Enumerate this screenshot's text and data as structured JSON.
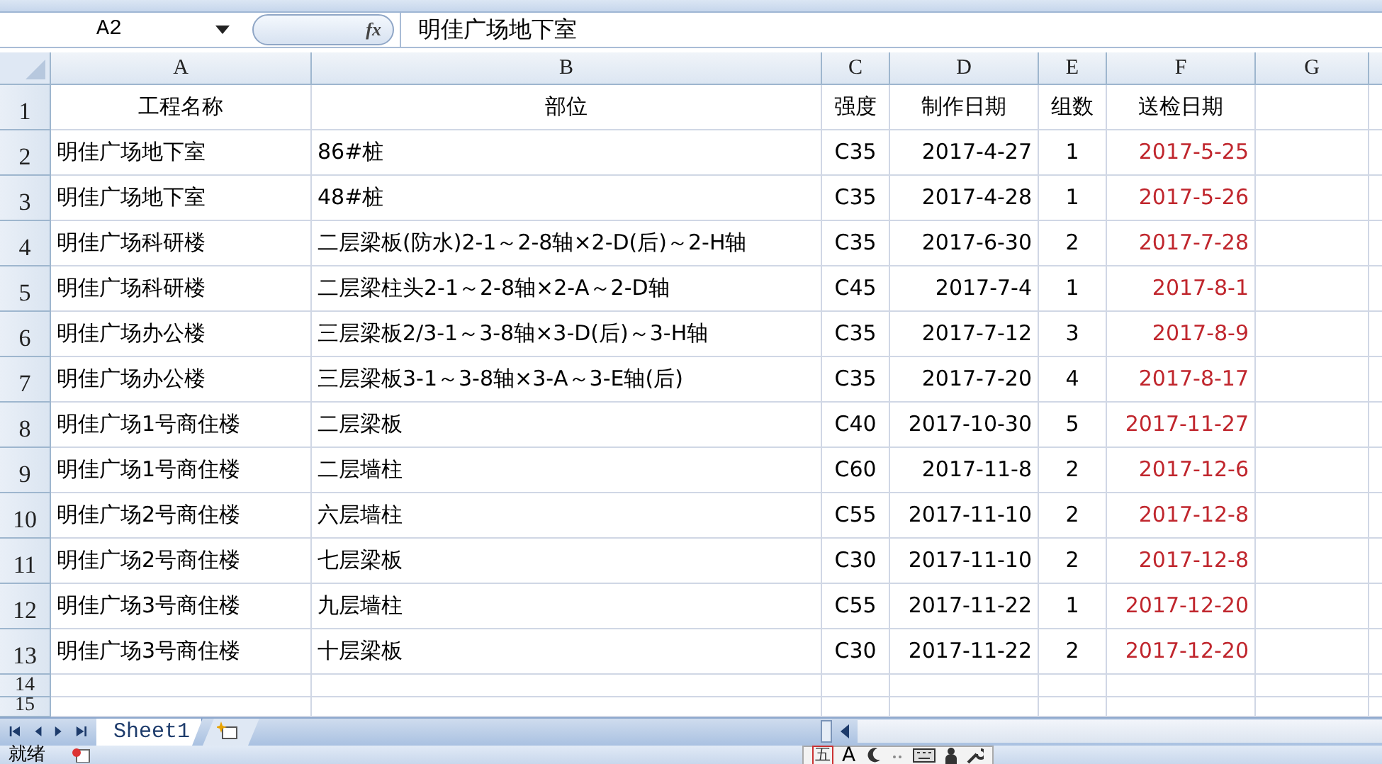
{
  "formula_bar": {
    "name_box": "A2",
    "fx": "fx",
    "value": "明佳广场地下室"
  },
  "columns": [
    "A",
    "B",
    "C",
    "D",
    "E",
    "F",
    "G"
  ],
  "header_row": {
    "number": "1",
    "cells": [
      "工程名称",
      "部位",
      "强度",
      "制作日期",
      "组数",
      "送检日期"
    ]
  },
  "rows": [
    {
      "number": "2",
      "cells": [
        "明佳广场地下室",
        "86#桩",
        "C35",
        "2017-4-27",
        "1",
        "2017-5-25"
      ]
    },
    {
      "number": "3",
      "cells": [
        "明佳广场地下室",
        "48#桩",
        "C35",
        "2017-4-28",
        "1",
        "2017-5-26"
      ]
    },
    {
      "number": "4",
      "cells": [
        "明佳广场科研楼",
        "二层梁板(防水)2-1～2-8轴×2-D(后)～2-H轴",
        "C35",
        "2017-6-30",
        "2",
        "2017-7-28"
      ]
    },
    {
      "number": "5",
      "cells": [
        "明佳广场科研楼",
        "二层梁柱头2-1～2-8轴×2-A～2-D轴",
        "C45",
        "2017-7-4",
        "1",
        "2017-8-1"
      ]
    },
    {
      "number": "6",
      "cells": [
        "明佳广场办公楼",
        "三层梁板2/3-1～3-8轴×3-D(后)～3-H轴",
        "C35",
        "2017-7-12",
        "3",
        "2017-8-9"
      ]
    },
    {
      "number": "7",
      "cells": [
        "明佳广场办公楼",
        "三层梁板3-1～3-8轴×3-A～3-E轴(后)",
        "C35",
        "2017-7-20",
        "4",
        "2017-8-17"
      ]
    },
    {
      "number": "8",
      "cells": [
        "明佳广场1号商住楼",
        "二层梁板",
        "C40",
        "2017-10-30",
        "5",
        "2017-11-27"
      ]
    },
    {
      "number": "9",
      "cells": [
        "明佳广场1号商住楼",
        "二层墙柱",
        "C60",
        "2017-11-8",
        "2",
        "2017-12-6"
      ]
    },
    {
      "number": "10",
      "cells": [
        "明佳广场2号商住楼",
        "六层墙柱",
        "C55",
        "2017-11-10",
        "2",
        "2017-12-8"
      ]
    },
    {
      "number": "11",
      "cells": [
        "明佳广场2号商住楼",
        "七层梁板",
        "C30",
        "2017-11-10",
        "2",
        "2017-12-8"
      ]
    },
    {
      "number": "12",
      "cells": [
        "明佳广场3号商住楼",
        "九层墙柱",
        "C55",
        "2017-11-22",
        "1",
        "2017-12-20"
      ]
    },
    {
      "number": "13",
      "cells": [
        "明佳广场3号商住楼",
        "十层梁板",
        "C30",
        "2017-11-22",
        "2",
        "2017-12-20"
      ]
    }
  ],
  "empty_rows": [
    "14",
    "15"
  ],
  "sheet_tabs": [
    {
      "label": "Sheet1",
      "selected": true
    }
  ],
  "status_bar": {
    "text": "就绪"
  },
  "ime_toolbar": {
    "mode": "五",
    "letter": "A"
  }
}
